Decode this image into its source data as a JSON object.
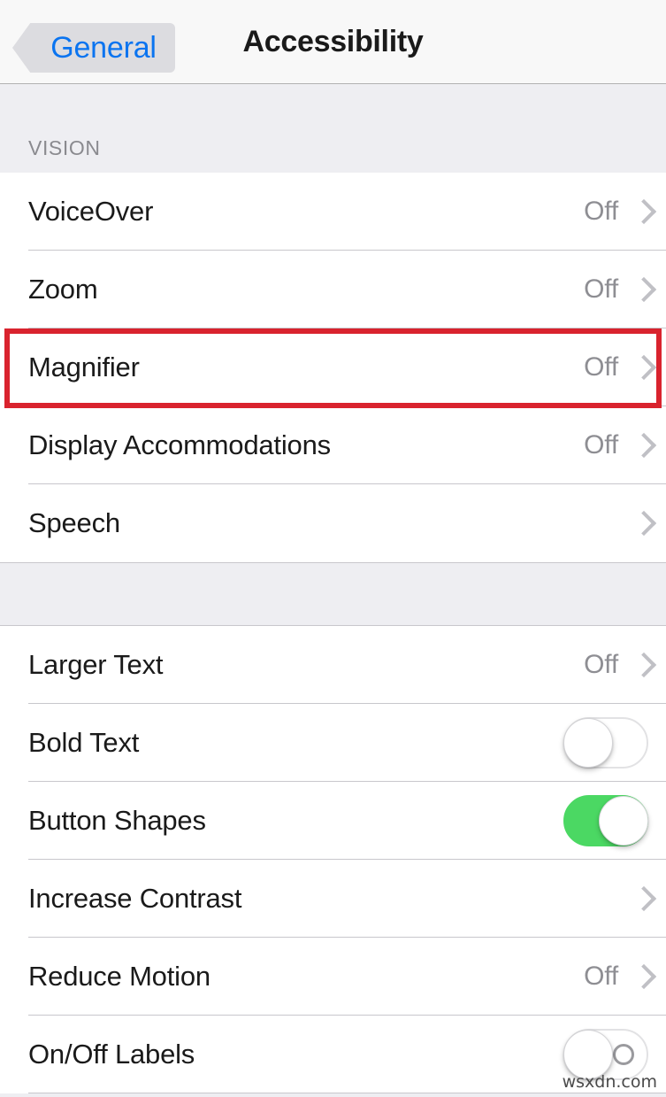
{
  "navbar": {
    "back_label": "General",
    "title": "Accessibility",
    "back_icon": "chevron-left-icon",
    "accent_color": "#0a74f0",
    "back_button_fill": "#dcdce0"
  },
  "sections": [
    {
      "header": "VISION",
      "rows": [
        {
          "label": "VoiceOver",
          "value": "Off",
          "accessory": "chevron",
          "icon": "chevron-right-icon"
        },
        {
          "label": "Zoom",
          "value": "Off",
          "accessory": "chevron",
          "icon": "chevron-right-icon"
        },
        {
          "label": "Magnifier",
          "value": "Off",
          "accessory": "chevron",
          "icon": "chevron-right-icon",
          "highlighted": true
        },
        {
          "label": "Display Accommodations",
          "value": "Off",
          "accessory": "chevron",
          "icon": "chevron-right-icon"
        },
        {
          "label": "Speech",
          "value": "",
          "accessory": "chevron",
          "icon": "chevron-right-icon"
        }
      ]
    },
    {
      "header": "",
      "rows": [
        {
          "label": "Larger Text",
          "value": "Off",
          "accessory": "chevron",
          "icon": "chevron-right-icon"
        },
        {
          "label": "Bold Text",
          "value": "",
          "accessory": "toggle",
          "toggle_state": "off",
          "icon": "toggle-switch-icon"
        },
        {
          "label": "Button Shapes",
          "value": "",
          "accessory": "toggle",
          "toggle_state": "on",
          "icon": "toggle-switch-icon"
        },
        {
          "label": "Increase Contrast",
          "value": "",
          "accessory": "chevron",
          "icon": "chevron-right-icon"
        },
        {
          "label": "Reduce Motion",
          "value": "Off",
          "accessory": "chevron",
          "icon": "chevron-right-icon"
        },
        {
          "label": "On/Off Labels",
          "value": "",
          "accessory": "toggle-labeled",
          "toggle_state": "off",
          "icon": "toggle-switch-icon"
        }
      ]
    }
  ],
  "annotation": {
    "target_row": "Magnifier",
    "color": "#d9232e"
  },
  "watermark": {
    "text": "wsxdn.com"
  }
}
